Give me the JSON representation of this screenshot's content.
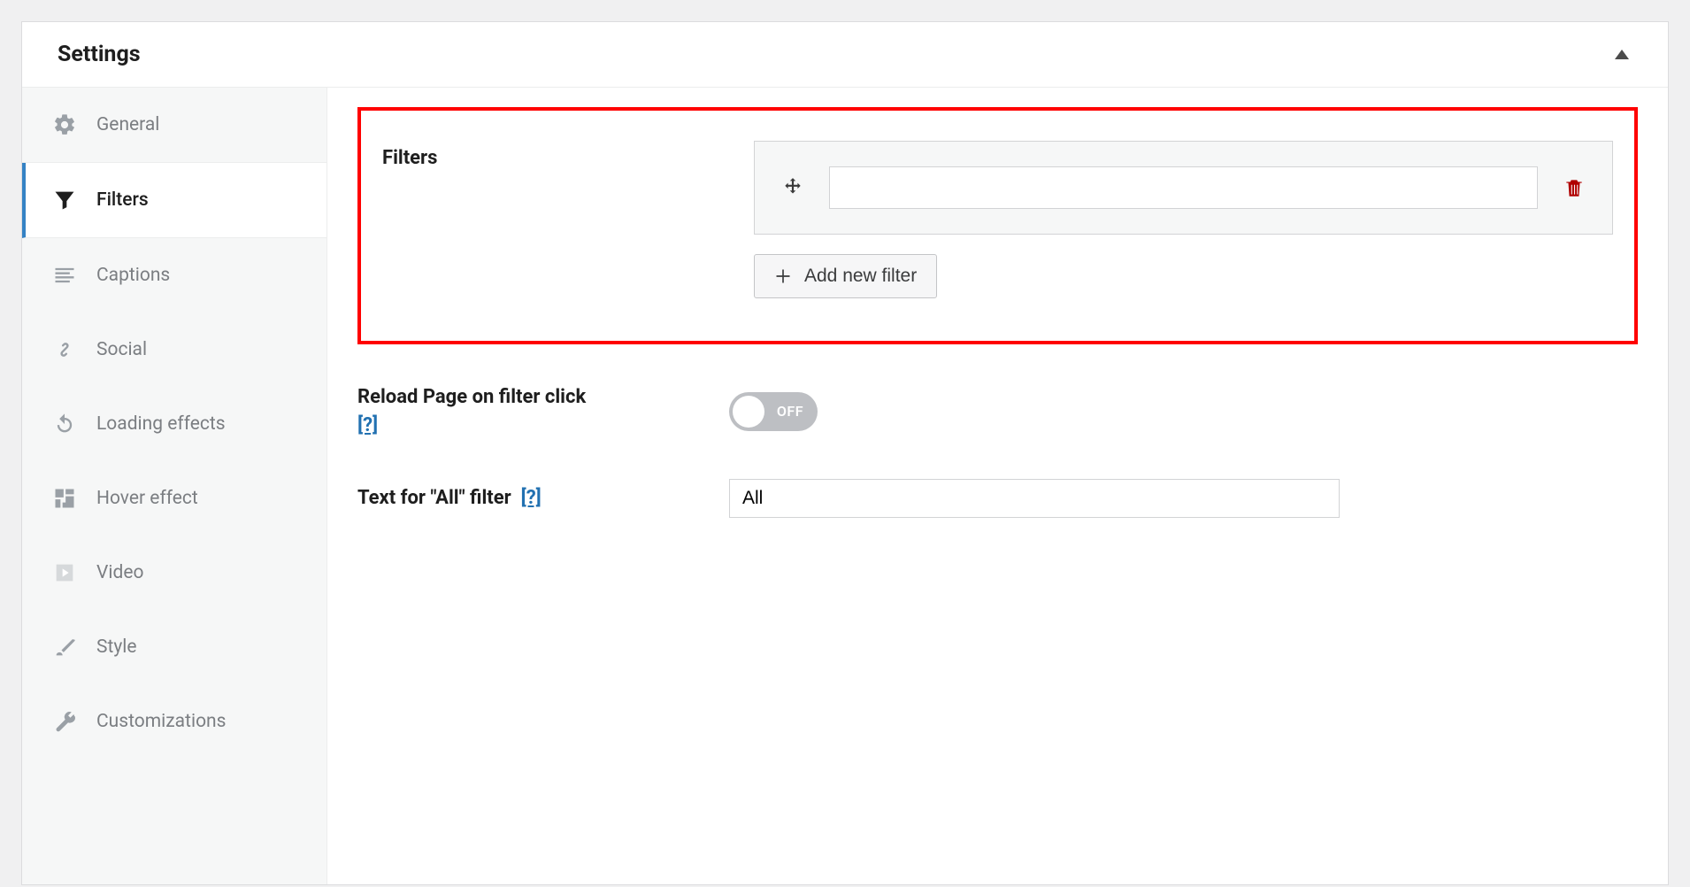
{
  "panel": {
    "title": "Settings"
  },
  "sidebar": {
    "items": [
      {
        "label": "General"
      },
      {
        "label": "Filters"
      },
      {
        "label": "Captions"
      },
      {
        "label": "Social"
      },
      {
        "label": "Loading effects"
      },
      {
        "label": "Hover effect"
      },
      {
        "label": "Video"
      },
      {
        "label": "Style"
      },
      {
        "label": "Customizations"
      }
    ]
  },
  "filters": {
    "section_label": "Filters",
    "filter_value": "",
    "add_button": "Add new filter"
  },
  "reload": {
    "label": "Reload Page on filter click",
    "help": "[?]",
    "toggle_text": "OFF"
  },
  "all_filter": {
    "label": "Text for \"All\" filter",
    "help": "[?]",
    "value": "All"
  }
}
